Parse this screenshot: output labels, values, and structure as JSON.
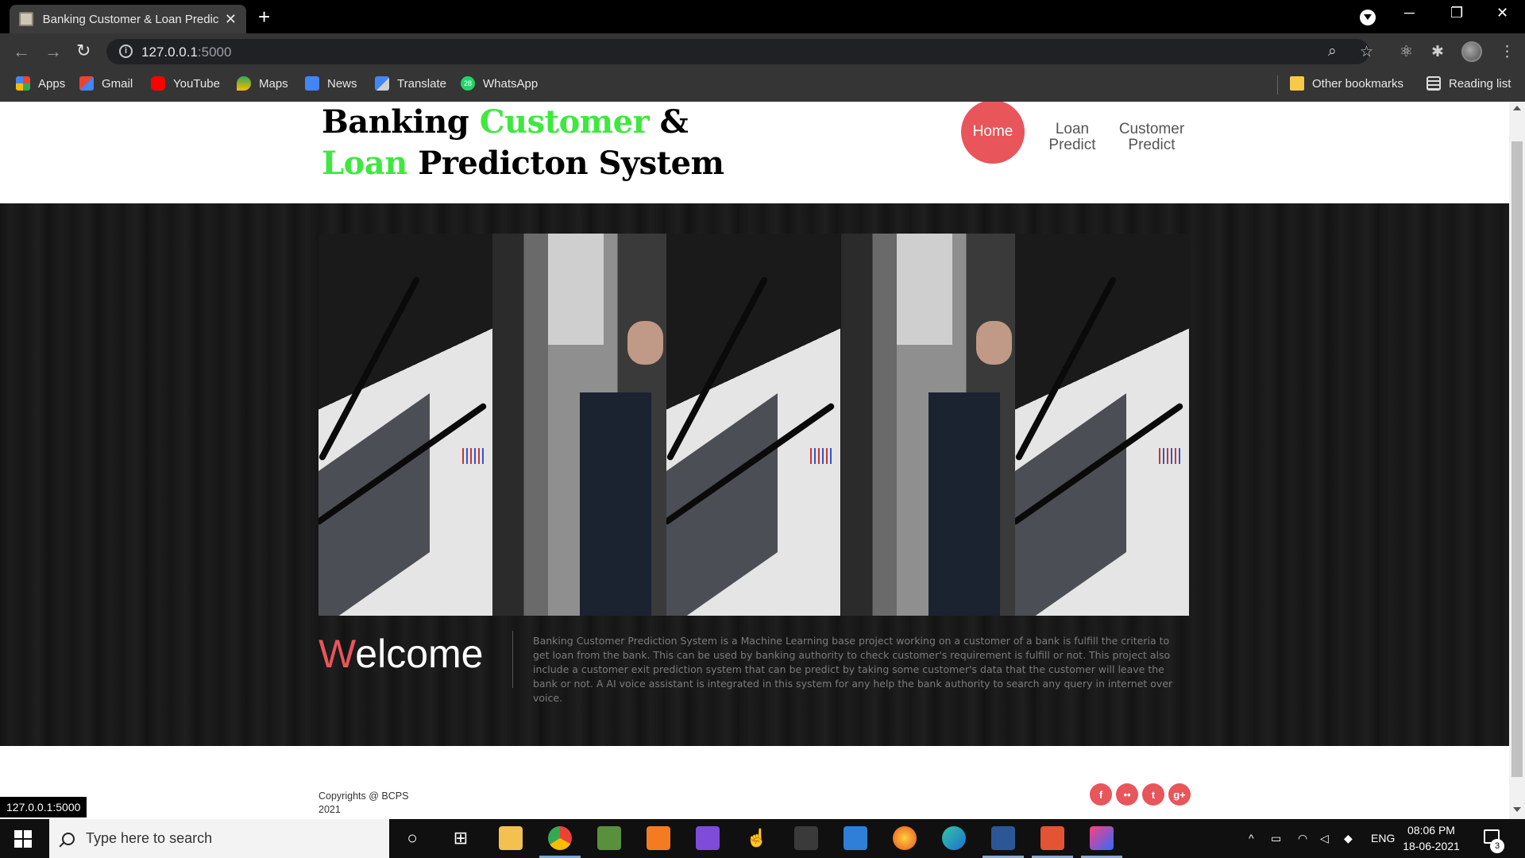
{
  "browser": {
    "tab_title": "Banking Customer & Loan Predic",
    "tab_close": "✕",
    "new_tab": "+",
    "url_host": "127.0.0.1",
    "url_port": ":5000",
    "bookmarks": [
      "Apps",
      "Gmail",
      "YouTube",
      "Maps",
      "News",
      "Translate",
      "WhatsApp"
    ],
    "other_bookmarks": "Other bookmarks",
    "reading_list": "Reading list",
    "whatsapp_badge": "28",
    "status_url": "127.0.0.1:5000"
  },
  "site": {
    "logo": {
      "line1_a": "Banking ",
      "line1_b": "Customer",
      "line1_c": " &",
      "line2_a": "Loan",
      "line2_b": " Predicton System"
    },
    "nav": {
      "home": "Home",
      "loan_1": "Loan",
      "loan_2": "Predict",
      "customer_1": "Customer",
      "customer_2": "Predict"
    },
    "welcome_first": "W",
    "welcome_rest": "elcome",
    "description": "Banking Customer Prediction System is a Machine Learning base project working on a customer of a bank is fulfill the criteria to get loan from the bank. This can be used by banking authority to check customer's requirement is fulfill or not. This project also include a customer exit prediction system that can be predict by taking some customer's data that the customer will leave the bank or not. A AI voice assistant is integrated in this system for any help the bank authority to search any query in internet over voice.",
    "copyright_1": "Copyrights @ BCPS",
    "copyright_2": "2021",
    "socials": [
      "f",
      "••",
      "t",
      "g+"
    ]
  },
  "taskbar": {
    "search_placeholder": "Type here to search",
    "lang": "ENG",
    "time": "08:06 PM",
    "date": "18-06-2021",
    "notifications": "3"
  },
  "colors": {
    "accent": "#e8555a",
    "logo_green": "#3ee83e"
  }
}
